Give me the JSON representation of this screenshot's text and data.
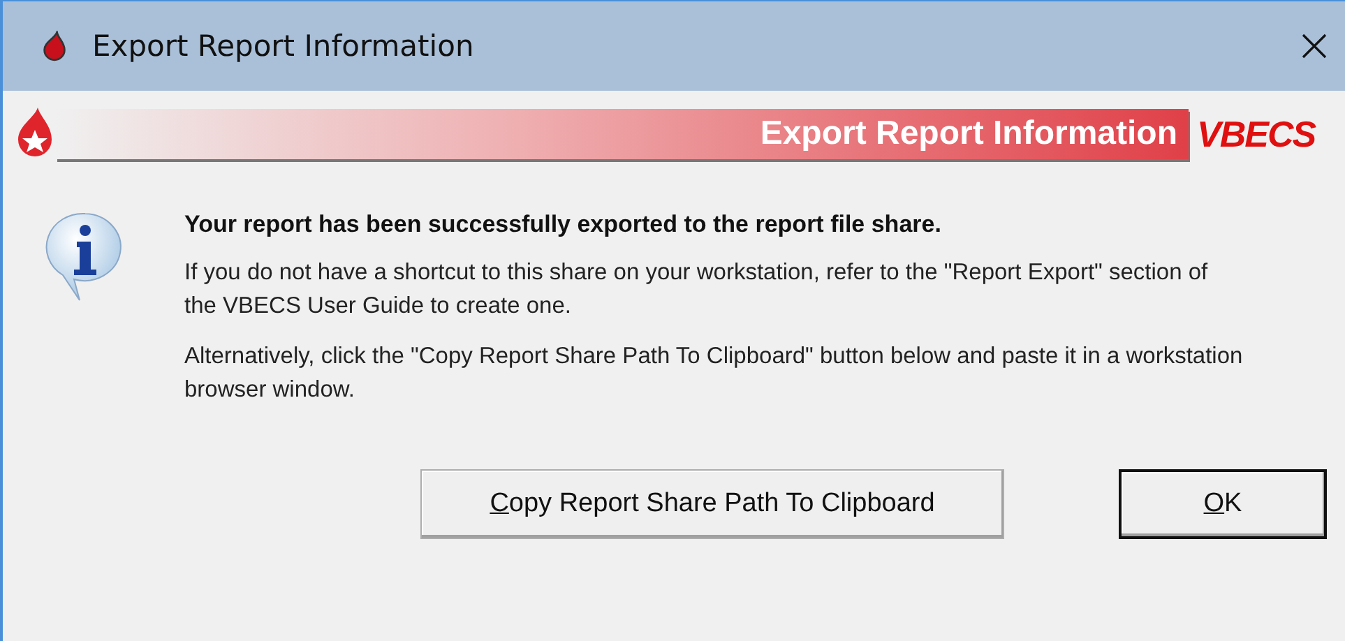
{
  "window": {
    "title": "Export Report Information"
  },
  "banner": {
    "title": "Export Report Information",
    "logo": "VBECS"
  },
  "message": {
    "heading": "Your report has been successfully exported to the report file share.",
    "paragraphs": [
      "If you do not have a shortcut to this share on your workstation, refer to the \"Report Export\" section of the VBECS User Guide to create one.",
      "Alternatively, click the \"Copy Report Share Path To Clipboard\" button below and paste it in a workstation browser window."
    ]
  },
  "buttons": [
    {
      "label": "Copy Report Share Path To Clipboard",
      "default": false,
      "mnemonic_underlined": true
    },
    {
      "label": "OK",
      "default": true,
      "mnemonic_underlined": true
    }
  ]
}
